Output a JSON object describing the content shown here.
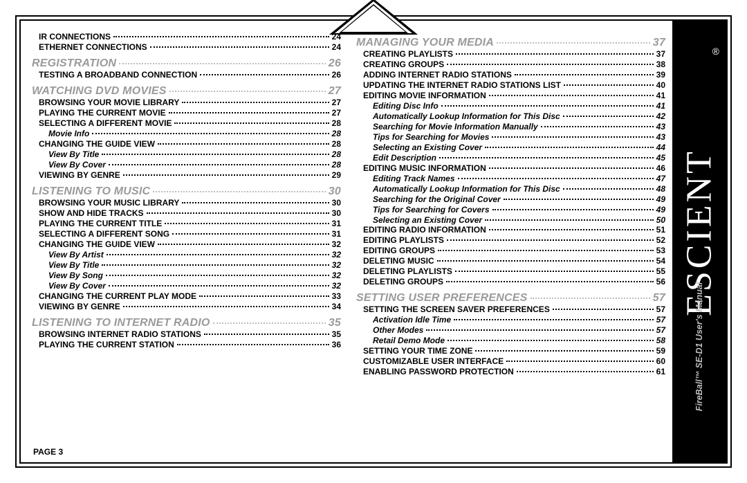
{
  "footer": {
    "page_label": "PAGE 3"
  },
  "sidebar": {
    "brand": "ESCIENT",
    "reg": "®",
    "product": "FireBall™ SE-D1",
    "manual": "User's Manual"
  },
  "left": [
    {
      "level": 1,
      "label": "IR CONNECTIONS",
      "page": "24"
    },
    {
      "level": 1,
      "label": "ETHERNET CONNECTIONS",
      "page": "24"
    },
    {
      "level": 0,
      "label": "REGISTRATION",
      "page": "26"
    },
    {
      "level": 1,
      "label": "TESTING A BROADBAND CONNECTION",
      "page": "26"
    },
    {
      "level": 0,
      "label": "WATCHING DVD MOVIES",
      "page": "27"
    },
    {
      "level": 1,
      "label": "BROWSING YOUR MOVIE LIBRARY",
      "page": "27"
    },
    {
      "level": 1,
      "label": "PLAYING THE CURRENT MOVIE",
      "page": "27"
    },
    {
      "level": 1,
      "label": "SELECTING A DIFFERENT MOVIE",
      "page": "28"
    },
    {
      "level": 2,
      "label": "Movie Info",
      "page": "28"
    },
    {
      "level": 1,
      "label": "CHANGING THE GUIDE VIEW",
      "page": "28"
    },
    {
      "level": 2,
      "label": "View By Title",
      "page": "28"
    },
    {
      "level": 2,
      "label": "View By Cover",
      "page": "28"
    },
    {
      "level": 1,
      "label": "VIEWING BY GENRE",
      "page": "29"
    },
    {
      "level": 0,
      "label": "LISTENING TO MUSIC",
      "page": "30"
    },
    {
      "level": 1,
      "label": "BROWSING YOUR MUSIC LIBRARY",
      "page": "30"
    },
    {
      "level": 1,
      "label": "SHOW AND HIDE TRACKS",
      "page": "30"
    },
    {
      "level": 1,
      "label": "PLAYING THE CURRENT TITLE",
      "page": "31"
    },
    {
      "level": 1,
      "label": "SELECTING A DIFFERENT SONG",
      "page": "31"
    },
    {
      "level": 1,
      "label": "CHANGING THE GUIDE VIEW",
      "page": "32"
    },
    {
      "level": 2,
      "label": "View By Artist",
      "page": "32"
    },
    {
      "level": 2,
      "label": "View By Title",
      "page": "32"
    },
    {
      "level": 2,
      "label": "View By Song",
      "page": "32"
    },
    {
      "level": 2,
      "label": "View By Cover",
      "page": "32"
    },
    {
      "level": 1,
      "label": "CHANGING THE CURRENT PLAY MODE",
      "page": "33"
    },
    {
      "level": 1,
      "label": "VIEWING BY GENRE",
      "page": "34"
    },
    {
      "level": 0,
      "label": "LISTENING TO INTERNET RADIO",
      "page": "35"
    },
    {
      "level": 1,
      "label": "BROWSING INTERNET RADIO STATIONS",
      "page": "35"
    },
    {
      "level": 1,
      "label": "PLAYING THE CURRENT STATION",
      "page": "36"
    }
  ],
  "right": [
    {
      "level": 0,
      "label": "MANAGING YOUR MEDIA",
      "page": "37"
    },
    {
      "level": 1,
      "label": "CREATING PLAYLISTS",
      "page": "37"
    },
    {
      "level": 1,
      "label": "CREATING GROUPS",
      "page": "38"
    },
    {
      "level": 1,
      "label": "ADDING INTERNET RADIO STATIONS",
      "page": "39"
    },
    {
      "level": 1,
      "label": "UPDATING THE INTERNET RADIO STATIONS LIST",
      "page": "40"
    },
    {
      "level": 1,
      "label": "EDITING MOVIE INFORMATION",
      "page": "41"
    },
    {
      "level": 2,
      "label": "Editing Disc Info",
      "page": "41"
    },
    {
      "level": 2,
      "label": "Automatically Lookup Information for This Disc",
      "page": "42"
    },
    {
      "level": 2,
      "label": "Searching for Movie Information Manually",
      "page": "43"
    },
    {
      "level": 2,
      "label": "Tips for Searching for Movies",
      "page": "43"
    },
    {
      "level": 2,
      "label": "Selecting an Existing Cover",
      "page": "44"
    },
    {
      "level": 2,
      "label": "Edit Description",
      "page": "45"
    },
    {
      "level": 1,
      "label": "EDITING MUSIC INFORMATION",
      "page": "46"
    },
    {
      "level": 2,
      "label": "Editing Track Names",
      "page": "47"
    },
    {
      "level": 2,
      "label": "Automatically Lookup Information for This Disc",
      "page": "48"
    },
    {
      "level": 2,
      "label": "Searching for the Original Cover",
      "page": "49"
    },
    {
      "level": 2,
      "label": "Tips for Searching for Covers",
      "page": "49"
    },
    {
      "level": 2,
      "label": "Selecting an Existing Cover",
      "page": "50"
    },
    {
      "level": 1,
      "label": "EDITING RADIO INFORMATION",
      "page": "51"
    },
    {
      "level": 1,
      "label": "EDITING PLAYLISTS",
      "page": "52"
    },
    {
      "level": 1,
      "label": "EDITING GROUPS",
      "page": "53"
    },
    {
      "level": 1,
      "label": "DELETING MUSIC",
      "page": "54"
    },
    {
      "level": 1,
      "label": "DELETING PLAYLISTS",
      "page": "55"
    },
    {
      "level": 1,
      "label": "DELETING GROUPS",
      "page": "56"
    },
    {
      "level": 0,
      "label": "SETTING USER PREFERENCES",
      "page": "57"
    },
    {
      "level": 1,
      "label": "SETTING THE SCREEN SAVER PREFERENCES",
      "page": "57"
    },
    {
      "level": 2,
      "label": "Activation Idle Time",
      "page": "57"
    },
    {
      "level": 2,
      "label": "Other Modes",
      "page": "57"
    },
    {
      "level": 2,
      "label": "Retail Demo Mode",
      "page": "58"
    },
    {
      "level": 1,
      "label": "SETTING YOUR TIME ZONE",
      "page": "59"
    },
    {
      "level": 1,
      "label": "CUSTOMIZABLE USER INTERFACE",
      "page": "60"
    },
    {
      "level": 1,
      "label": "ENABLING PASSWORD PROTECTION",
      "page": "61"
    }
  ]
}
